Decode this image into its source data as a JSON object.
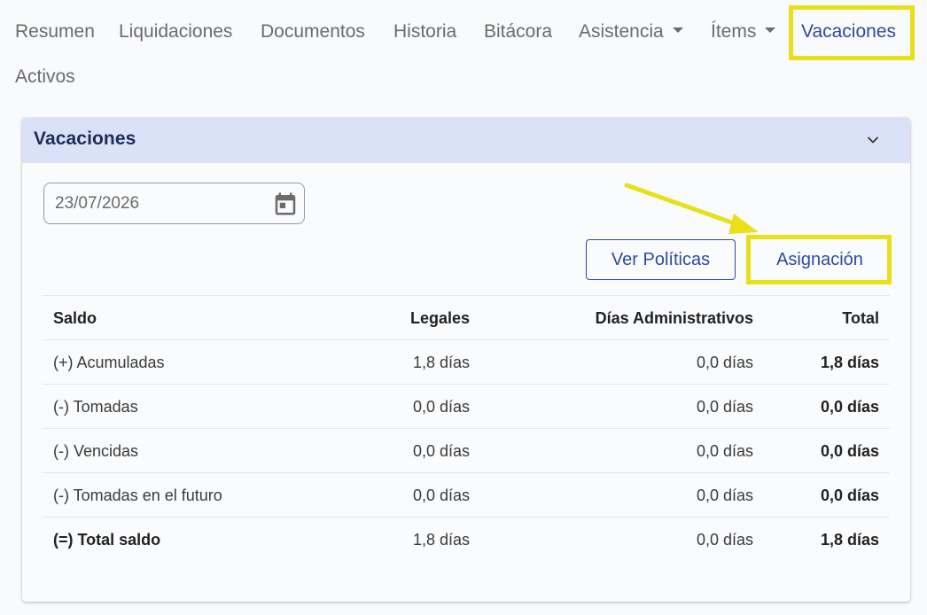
{
  "nav": {
    "items": [
      {
        "label": "Resumen"
      },
      {
        "label": "Liquidaciones"
      },
      {
        "label": "Documentos"
      },
      {
        "label": "Historia"
      },
      {
        "label": "Bitácora"
      },
      {
        "label": "Asistencia",
        "dropdown": true
      },
      {
        "label": "Ítems",
        "dropdown": true
      },
      {
        "label": "Vacaciones",
        "active": true
      },
      {
        "label": "Activos"
      }
    ]
  },
  "card": {
    "title": "Vacaciones",
    "date_value": "23/07/2026",
    "buttons": {
      "policies": "Ver Políticas",
      "assignment": "Asignación"
    },
    "table": {
      "headers": [
        "Saldo",
        "Legales",
        "Días Administrativos",
        "Total"
      ],
      "rows": [
        [
          "(+) Acumuladas",
          "1,8 días",
          "0,0 días",
          "1,8 días"
        ],
        [
          "(-) Tomadas",
          "0,0 días",
          "0,0 días",
          "0,0 días"
        ],
        [
          "(-) Vencidas",
          "0,0 días",
          "0,0 días",
          "0,0 días"
        ],
        [
          "(-) Tomadas en el futuro",
          "0,0 días",
          "0,0 días",
          "0,0 días"
        ],
        [
          "(=) Total saldo",
          "1,8 días",
          "0,0 días",
          "1,8 días"
        ]
      ]
    }
  },
  "colors": {
    "accent": "#2d4aa3",
    "highlight": "#e9e01a",
    "header_bg": "#d9e2f7"
  },
  "icons": {
    "date": "calendar-icon",
    "collapse": "chevron-down-icon",
    "dropdown": "caret-down-icon"
  }
}
